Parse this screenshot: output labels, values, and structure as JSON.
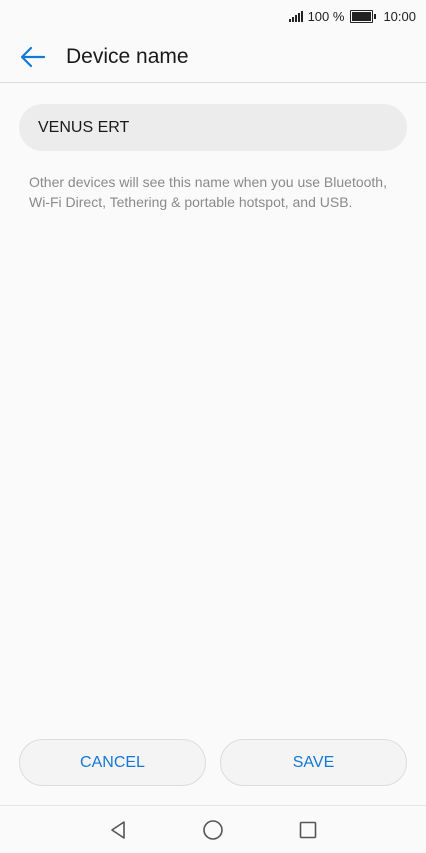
{
  "status_bar": {
    "battery_percent": "100 %",
    "time": "10:00"
  },
  "app_bar": {
    "title": "Device name",
    "back_icon": "arrow-left-icon"
  },
  "device_name_field": {
    "value": "VENUS ERT"
  },
  "hint_text": "Other devices will see this name when you use Bluetooth, Wi-Fi Direct, Tethering & portable hotspot, and USB.",
  "buttons": {
    "cancel_label": "CANCEL",
    "save_label": "SAVE"
  },
  "colors": {
    "accent": "#1478d4",
    "background": "#fafafa",
    "field_background": "#ececec",
    "hint_text": "#8a8a8a"
  },
  "nav_bar": {
    "icons": [
      "triangle-back-icon",
      "circle-home-icon",
      "square-recents-icon"
    ]
  }
}
